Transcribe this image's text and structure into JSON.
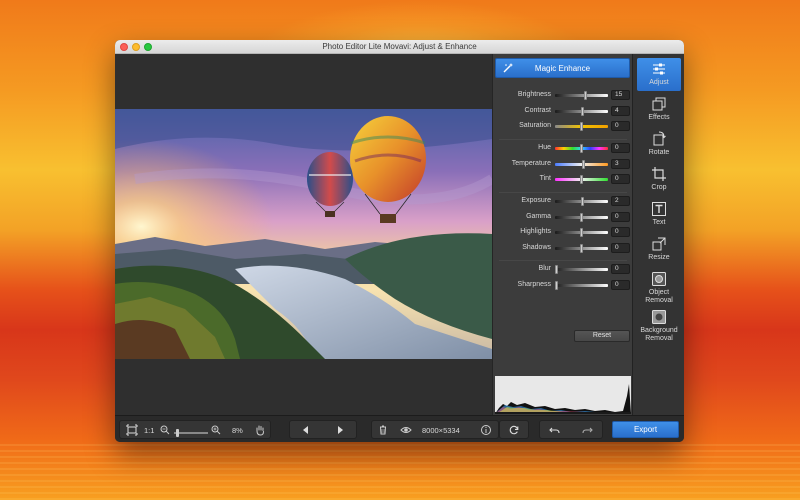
{
  "window": {
    "title": "Photo Editor Lite Movavi: Adjust & Enhance"
  },
  "panel": {
    "magic_enhance": "Magic Enhance",
    "reset": "Reset",
    "groups": [
      {
        "sliders": [
          {
            "label": "Brightness",
            "value": "15",
            "level": 0.58,
            "track": "bw"
          },
          {
            "label": "Contrast",
            "value": "4",
            "level": 0.52,
            "track": "bw"
          },
          {
            "label": "Saturation",
            "value": "0",
            "level": 0.5,
            "track": "sat"
          }
        ]
      },
      {
        "sliders": [
          {
            "label": "Hue",
            "value": "0",
            "level": 0.5,
            "track": "hue"
          },
          {
            "label": "Temperature",
            "value": "3",
            "level": 0.53,
            "track": "temp"
          },
          {
            "label": "Tint",
            "value": "0",
            "level": 0.5,
            "track": "tint"
          }
        ]
      },
      {
        "sliders": [
          {
            "label": "Exposure",
            "value": "2",
            "level": 0.52,
            "track": "bw"
          },
          {
            "label": "Gamma",
            "value": "0",
            "level": 0.5,
            "track": "bw"
          },
          {
            "label": "Highlights",
            "value": "0",
            "level": 0.5,
            "track": "bw"
          },
          {
            "label": "Shadows",
            "value": "0",
            "level": 0.5,
            "track": "bw"
          }
        ]
      },
      {
        "sliders": [
          {
            "label": "Blur",
            "value": "0",
            "level": 0.0,
            "track": "bw"
          },
          {
            "label": "Sharpness",
            "value": "0",
            "level": 0.0,
            "track": "bw"
          }
        ]
      }
    ]
  },
  "sidebar": {
    "tools": [
      {
        "label": "Adjust",
        "icon": "sliders-icon",
        "active": true
      },
      {
        "label": "Effects",
        "icon": "layers-icon",
        "active": false
      },
      {
        "label": "Rotate",
        "icon": "rotate-icon",
        "active": false
      },
      {
        "label": "Crop",
        "icon": "crop-icon",
        "active": false
      },
      {
        "label": "Text",
        "icon": "text-icon",
        "active": false
      },
      {
        "label": "Resize",
        "icon": "resize-icon",
        "active": false
      },
      {
        "label": "Object\nRemoval",
        "icon": "object-removal-icon",
        "active": false
      },
      {
        "label": "Background\nRemoval",
        "icon": "background-removal-icon",
        "active": false
      }
    ]
  },
  "bottombar": {
    "one_to_one": "1:1",
    "zoom_percent": "8%",
    "zoom_level": 0.05,
    "dimensions": "8000×5334",
    "export": "Export"
  },
  "colors": {
    "accent": "#3a86e0",
    "panel_bg": "#3c3c3c",
    "canvas_bg": "#2f2f2f"
  }
}
